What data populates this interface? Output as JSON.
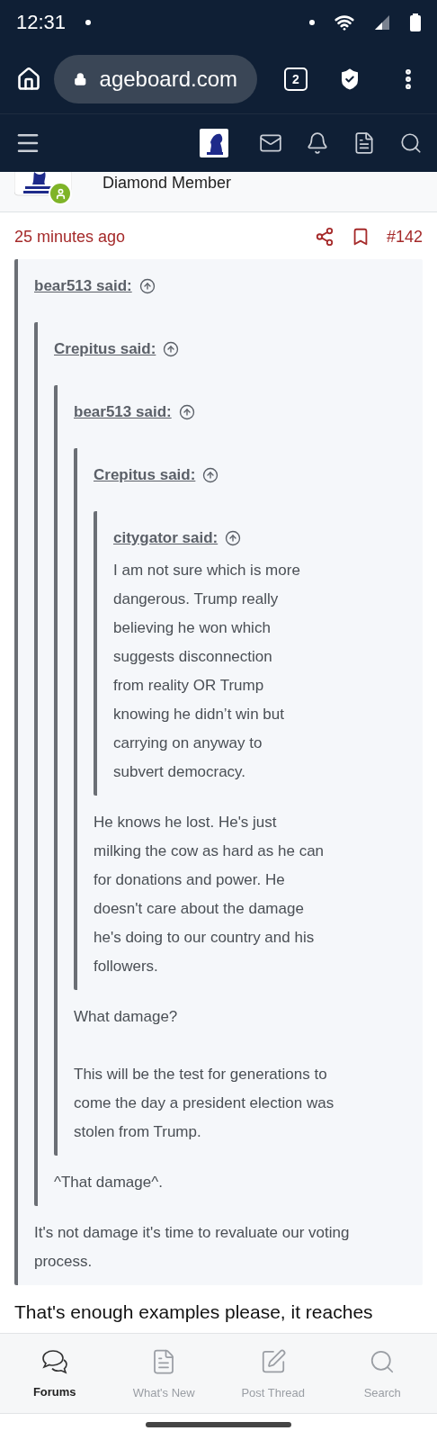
{
  "status_bar": {
    "time": "12:31"
  },
  "browser": {
    "url": "ageboard.com",
    "tab_count": "2"
  },
  "post": {
    "user_title": "Diamond Member",
    "time": "25 minutes ago",
    "number": "#142",
    "quote": {
      "attribution": "bear513 said:",
      "paragraphs": [
        "It's not damage it's time to revaluate our voting process."
      ],
      "quote": {
        "attribution": "Crepitus said:",
        "paragraphs": [
          "^That damage^."
        ],
        "quote": {
          "attribution": "bear513 said:",
          "paragraphs": [
            "What damage?",
            "This will be the test for generations to come the day a president election was stolen from Trump."
          ],
          "quote": {
            "attribution": "Crepitus said:",
            "paragraphs": [
              "He knows he lost. He's just milking the cow as hard as he can for donations and power. He doesn't care about the damage he's doing to our country and his followers."
            ],
            "quote": {
              "attribution": "citygator said:",
              "paragraphs": [
                "I am not sure which is more dangerous. Trump really believing he won which suggests disconnection from reality OR Trump knowing he didn’t win but carrying on anyway to subvert democracy."
              ]
            }
          }
        }
      }
    },
    "text": "That's enough examples please, it reaches"
  },
  "bottom_tabs": [
    {
      "kind": "forums",
      "label": "Forums",
      "selected": true
    },
    {
      "kind": "whats_new",
      "label": "What's New",
      "selected": false
    },
    {
      "kind": "post_thread",
      "label": "Post Thread",
      "selected": false
    },
    {
      "kind": "search",
      "label": "Search",
      "selected": false
    }
  ]
}
